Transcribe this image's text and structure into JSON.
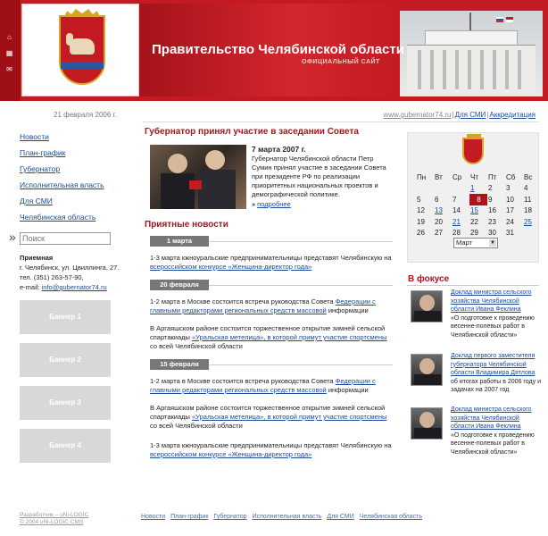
{
  "header": {
    "title": "Правительство Челябинской области",
    "subtitle": "ОФИЦИАЛЬНЫЙ САЙТ"
  },
  "topbar": {
    "date": "21 февраля 2006 г.",
    "links": [
      "www.gubernator74.ru",
      "Для СМИ",
      "Аккредитация"
    ]
  },
  "leftnav": {
    "items": [
      "Новости",
      "План-график",
      "Губернатор",
      "Исполнительная власть",
      "Для СМИ",
      "Челябинская область"
    ]
  },
  "search": {
    "placeholder": "Поиск"
  },
  "contacts": {
    "heading": "Приемная",
    "address": "г. Челябинск, ул. Цвиллинга, 27.",
    "phone": "тел. (351) 263-57-90,",
    "email_label": "e-mail:",
    "email": "info@gubernator74.ru"
  },
  "banners": [
    "Баннер 1",
    "Баннер 2",
    "Баннер 3",
    "Баннер 4"
  ],
  "lead": {
    "title": "Губернатор принял участие в заседании  Совета",
    "date": "7 марта 2007 г.",
    "text": "Губернатор Челябинской области Петр Сумин принял участие в заседании Совета при президенте РФ по реализации приоритетных национальных проектов и демографической политике.",
    "more": "подробнее"
  },
  "news": {
    "title": "Приятные новости",
    "groups": [
      {
        "date": "1 марта",
        "items": [
          {
            "pre": "1-3 марта кжноуральские предпринимательницы представят Челябинскую на ",
            "link": "всероссийском конкурсе «Женщина-директор года»",
            "post": ""
          }
        ]
      },
      {
        "date": "20 февраля",
        "items": [
          {
            "pre": "1-2 марта в Москве состоится встреча руководства Совета ",
            "link": "Федерации с главными редакторами региональных средств массовой",
            "post": " информации"
          },
          {
            "pre": "В Аргаяшском районе состоится торжественное открытие зимней сельской спартакиады ",
            "link": "«Уральская метелица», в которой примут участие спортсмены",
            "post": " со всей Челябинской области"
          }
        ]
      },
      {
        "date": "15 февраля",
        "items": [
          {
            "pre": "1-2 марта в Москве состоится встреча руководства Совета ",
            "link": "Федерации с главными редакторами региональных средств массовой",
            "post": " информации"
          },
          {
            "pre": "В Аргаяшском районе состоится торжественное открытие зимней сельской спартакиады ",
            "link": "«Уральская метелица», в которой примут участие спортсмены",
            "post": " со всей Челябинской области"
          },
          {
            "pre": "1-3 марта кжноуральские предпринимательницы представят Челябинскую на ",
            "link": "всероссийском конкурсе «Женщина-директор года»",
            "post": ""
          }
        ]
      }
    ]
  },
  "calendar": {
    "weekdays": [
      "Пн",
      "Вт",
      "Ср",
      "Чт",
      "Пт",
      "Сб",
      "Вс"
    ],
    "weeks": [
      [
        "",
        "",
        "",
        "1",
        "2",
        "3",
        "4"
      ],
      [
        "5",
        "6",
        "7",
        "8",
        "9",
        "10",
        "11"
      ],
      [
        "12",
        "13",
        "14",
        "15",
        "16",
        "17",
        "18"
      ],
      [
        "19",
        "20",
        "21",
        "22",
        "23",
        "24",
        "25"
      ],
      [
        "26",
        "27",
        "28",
        "29",
        "30",
        "31",
        ""
      ]
    ],
    "selected": "8",
    "month": "Март"
  },
  "focus": {
    "title": "В фокусе",
    "items": [
      {
        "link": "Доклад министра сельского хозяйства Челябинской области Ивана Феклина",
        "text": "«О подготовке к проведению весенне-полевых работ в Челябинской области»"
      },
      {
        "link": "Доклад первого заместителя губернатора Челябинской области Владимира Дятлова",
        "text": "об итогах работы в 2006 году и задачах на 2007 год"
      },
      {
        "link": "Доклад министра сельского хозяйства Челябинской области Ивана Феклина",
        "text": "«О подготовке к проведению весенне-полевых работ в Челябинской области»"
      }
    ]
  },
  "footer": {
    "dev": "Разработчик – uNi-LOGIC",
    "cms": "© 2004 uNi-LOGIC CMS",
    "nav": [
      "Новости",
      "План-график",
      "Губернатор",
      "Исполнительная власть",
      "Для СМИ",
      "Челябинская область"
    ]
  },
  "colors": {
    "brand_red": "#c41a22",
    "link_blue": "#1a4a9c"
  }
}
